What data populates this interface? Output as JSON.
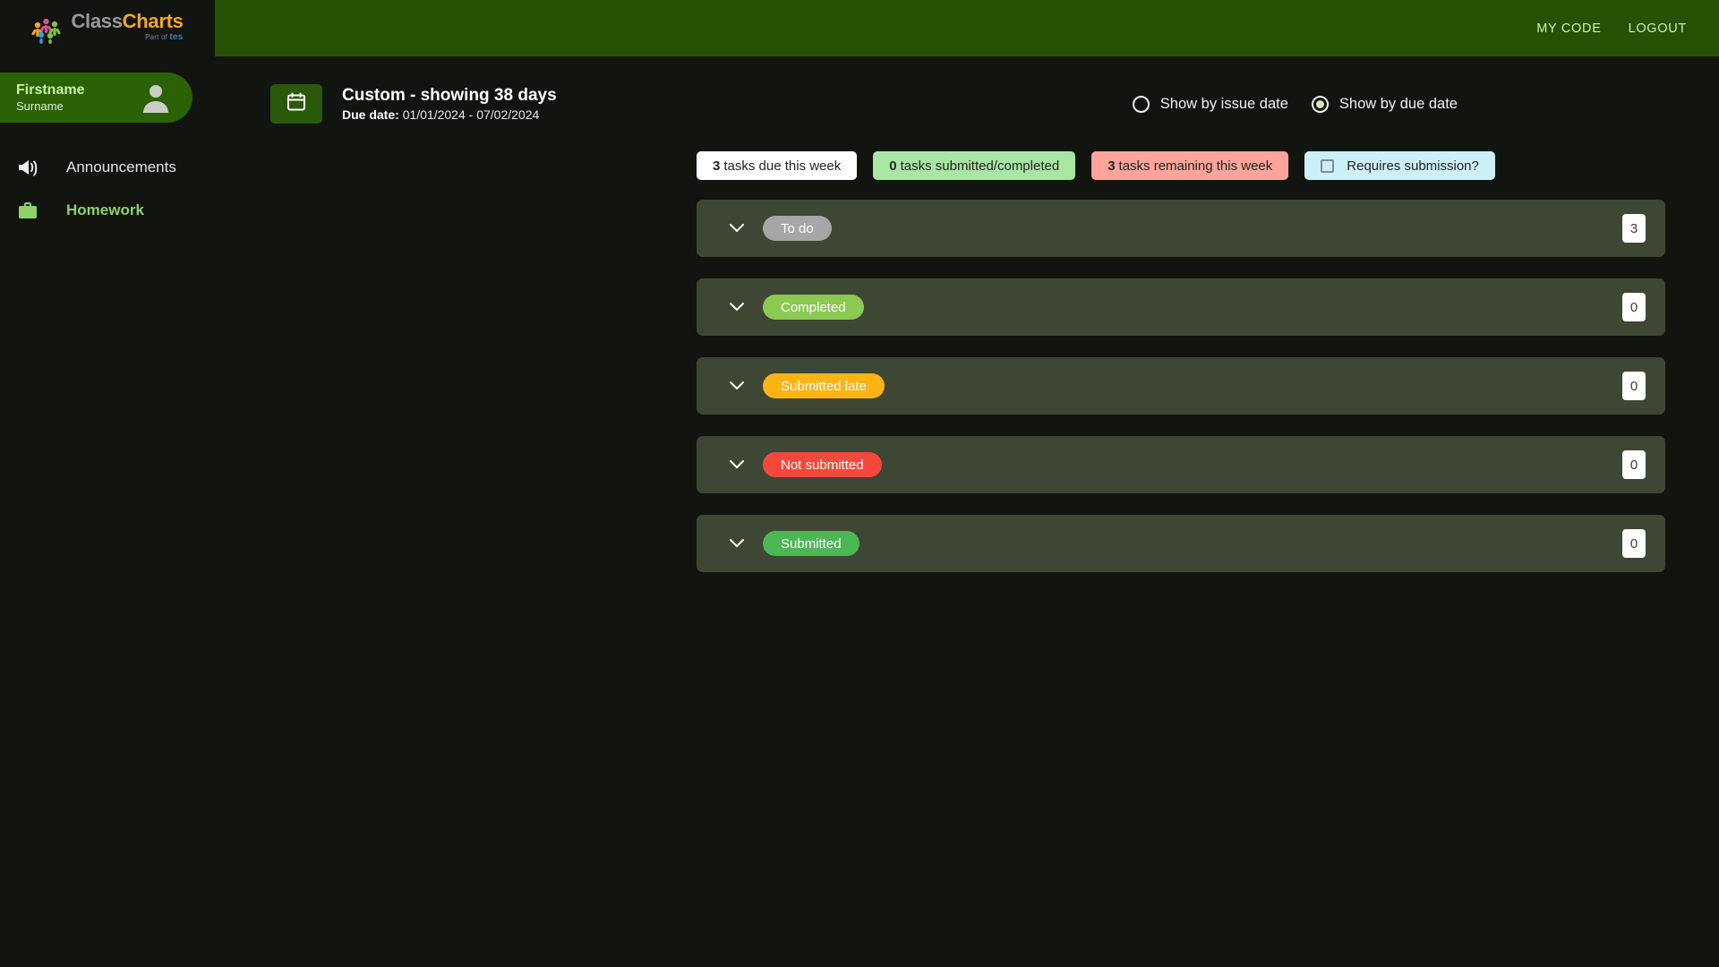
{
  "brand": {
    "name_part1": "Class",
    "name_part2": "Charts",
    "tagline_pre": "Part of ",
    "tagline_brand": "tes"
  },
  "topbar": {
    "my_code": "MY CODE",
    "logout": "LOGOUT"
  },
  "profile": {
    "firstname": "Firstname",
    "surname": "Surname"
  },
  "sidebar": {
    "items": [
      {
        "label": "Announcements",
        "icon": "megaphone-icon",
        "active": false
      },
      {
        "label": "Homework",
        "icon": "briefcase-icon",
        "active": true
      }
    ]
  },
  "header": {
    "calendar_icon": "calendar-icon",
    "title": "Custom - showing 38 days",
    "due_label": "Due date:",
    "due_range": "01/01/2024 - 07/02/2024"
  },
  "view_options": [
    {
      "label": "Show by issue date",
      "selected": false
    },
    {
      "label": "Show by due date",
      "selected": true
    }
  ],
  "pills": [
    {
      "count": "3",
      "label": "tasks due this week",
      "style": "white"
    },
    {
      "count": "0",
      "label": "tasks submitted/completed",
      "style": "green"
    },
    {
      "count": "3",
      "label": "tasks remaining this week",
      "style": "red"
    }
  ],
  "requires_submission": {
    "label": "Requires submission?",
    "checked": false
  },
  "status_rows": [
    {
      "label": "To do",
      "count": "3",
      "badge_class": "b-todo"
    },
    {
      "label": "Completed",
      "count": "0",
      "badge_class": "b-completed"
    },
    {
      "label": "Submitted late",
      "count": "0",
      "badge_class": "b-late"
    },
    {
      "label": "Not submitted",
      "count": "0",
      "badge_class": "b-not"
    },
    {
      "label": "Submitted",
      "count": "0",
      "badge_class": "b-submitted"
    }
  ],
  "colors": {
    "brand_green": "#275206",
    "accent_green": "#8ed06a",
    "row_bg": "#3e4733",
    "page_bg": "#121410"
  }
}
